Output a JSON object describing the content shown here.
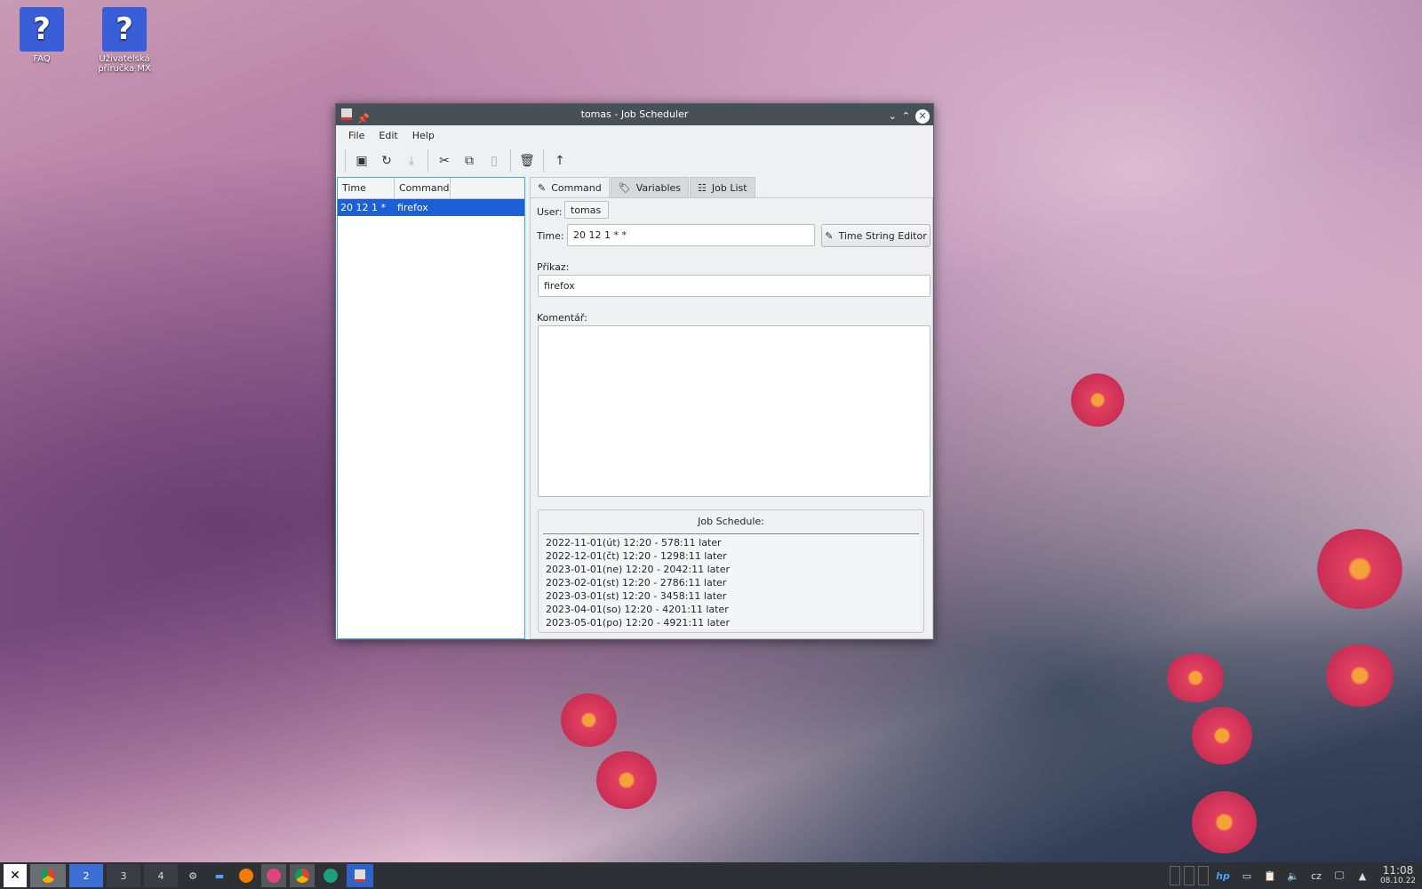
{
  "desktop": {
    "icons": [
      {
        "label": "FAQ"
      },
      {
        "label": "Uživatelská příručka MX"
      }
    ]
  },
  "window": {
    "title": "tomas - Job Scheduler"
  },
  "menu": [
    "File",
    "Edit",
    "Help"
  ],
  "toolbar": [
    "new-job",
    "reload",
    "save",
    "cut",
    "copy",
    "paste",
    "delete",
    "up"
  ],
  "job_list": {
    "columns": [
      "Time",
      "Command"
    ],
    "rows": [
      {
        "time": "20 12 1 * *",
        "command": "firefox"
      }
    ]
  },
  "tabs": [
    {
      "label": "Command",
      "icon": "pencil-icon"
    },
    {
      "label": "Variables",
      "icon": "tag-icon"
    },
    {
      "label": "Job List",
      "icon": "list-icon"
    }
  ],
  "command": {
    "user_label": "User:",
    "user": "tomas",
    "time_label": "Time:",
    "time": "20 12 1 * *",
    "time_editor_button": "Time String Editor",
    "command_label": "Příkaz:",
    "command": "firefox",
    "comment_label": "Komentář:",
    "comment": ""
  },
  "schedule": {
    "title": "Job Schedule:",
    "entries": [
      "2022-11-01(út) 12:20 - 578:11 later",
      "2022-12-01(čt) 12:20 - 1298:11 later",
      "2023-01-01(ne) 12:20 - 2042:11 later",
      "2023-02-01(st) 12:20 - 2786:11 later",
      "2023-03-01(st) 12:20 - 3458:11 later",
      "2023-04-01(so) 12:20 - 4201:11 later",
      "2023-05-01(po) 12:20 - 4921:11 later"
    ]
  },
  "taskbar": {
    "workspaces": [
      "2",
      "3",
      "4"
    ],
    "keyboard_layout": "cz",
    "time": "11:08",
    "date": "08.10.22"
  }
}
